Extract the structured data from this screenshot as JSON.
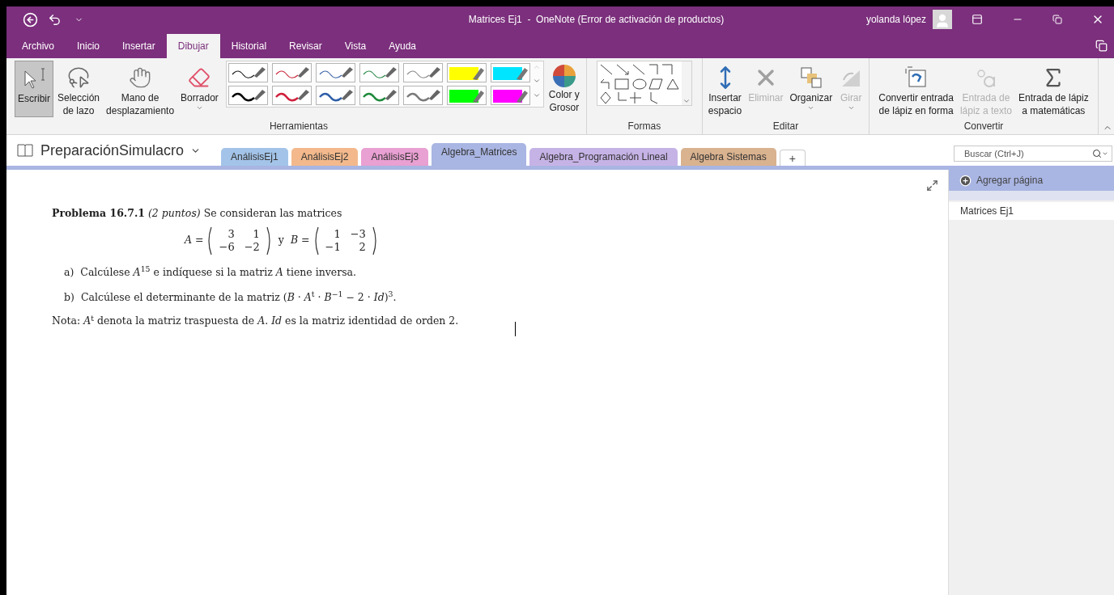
{
  "title_bar": {
    "title": "Matrices Ej1  -  OneNote (Error de activación de productos)",
    "user": "yolanda lópez"
  },
  "menu_tabs": [
    {
      "label": "Archivo",
      "selected": false
    },
    {
      "label": "Inicio",
      "selected": false
    },
    {
      "label": "Insertar",
      "selected": false
    },
    {
      "label": "Dibujar",
      "selected": true
    },
    {
      "label": "Historial",
      "selected": false
    },
    {
      "label": "Revisar",
      "selected": false
    },
    {
      "label": "Vista",
      "selected": false
    },
    {
      "label": "Ayuda",
      "selected": false
    }
  ],
  "ribbon": {
    "tools": {
      "label": "Herramientas",
      "buttons": [
        {
          "kind": "write",
          "lines": [
            "Escribir"
          ],
          "selected": true,
          "dropdown": false
        },
        {
          "kind": "lasso",
          "lines": [
            "Selección",
            "de lazo"
          ],
          "selected": false,
          "dropdown": false
        },
        {
          "kind": "hand",
          "lines": [
            "Mano de",
            "desplazamiento"
          ],
          "selected": false,
          "dropdown": false
        },
        {
          "kind": "eraser",
          "lines": [
            "Borrador"
          ],
          "selected": false,
          "dropdown": true
        }
      ],
      "pens": [
        {
          "kind": "pen",
          "color": "#1a1a1a"
        },
        {
          "kind": "pen",
          "color": "#c8283a"
        },
        {
          "kind": "pen",
          "color": "#3c64a8"
        },
        {
          "kind": "pen",
          "color": "#2e8a4c"
        },
        {
          "kind": "pen",
          "color": "#8a8a8a"
        },
        {
          "kind": "highlighter",
          "color": "#ffff00"
        },
        {
          "kind": "highlighter",
          "color": "#00e5ff"
        },
        {
          "kind": "pen",
          "color": "#000000"
        },
        {
          "kind": "pen",
          "color": "#d0203c"
        },
        {
          "kind": "pen",
          "color": "#2f5fa8"
        },
        {
          "kind": "pen",
          "color": "#1f8a3c"
        },
        {
          "kind": "pen",
          "color": "#7a7a7a"
        },
        {
          "kind": "highlighter",
          "color": "#00ff00"
        },
        {
          "kind": "highlighter",
          "color": "#ff00ff"
        }
      ],
      "color_button": [
        "Color y",
        "Grosor"
      ]
    },
    "shapes": {
      "label": "Formas"
    },
    "edit": {
      "label": "Editar",
      "buttons": [
        {
          "kind": "space",
          "lines": [
            "Insertar",
            "espacio"
          ],
          "disabled": false,
          "dropdown": false
        },
        {
          "kind": "delete",
          "lines": [
            "Eliminar"
          ],
          "disabled": true,
          "dropdown": false
        },
        {
          "kind": "arrange",
          "lines": [
            "Organizar"
          ],
          "disabled": false,
          "dropdown": true
        },
        {
          "kind": "rotate",
          "lines": [
            "Girar"
          ],
          "disabled": true,
          "dropdown": true
        }
      ]
    },
    "convert": {
      "label": "Convertir",
      "buttons": [
        {
          "kind": "shape",
          "lines": [
            "Convertir entrada",
            "de lápiz en forma"
          ],
          "disabled": false
        },
        {
          "kind": "text",
          "lines": [
            "Entrada de",
            "lápiz a texto"
          ],
          "disabled": true
        },
        {
          "kind": "math",
          "lines": [
            "Entrada de lápiz",
            "a matemáticas"
          ],
          "disabled": false
        }
      ]
    }
  },
  "notebook": {
    "name": "PreparaciónSimulacro",
    "sections": [
      {
        "label": "AnálisisEj1",
        "color": "#a3c4e8",
        "selected": false
      },
      {
        "label": "AnálisisEj2",
        "color": "#f3b98c",
        "selected": false
      },
      {
        "label": "AnálisisEj3",
        "color": "#e9a0d2",
        "selected": false
      },
      {
        "label": "Algebra_Matrices",
        "color": "#a9b5e2",
        "selected": true
      },
      {
        "label": "Algebra_Programación Lineal",
        "color": "#c6b3e6",
        "selected": false
      },
      {
        "label": "Algebra Sistemas",
        "color": "#d9b28f",
        "selected": false
      }
    ],
    "add_section": "+"
  },
  "search": {
    "placeholder": "Buscar (Ctrl+J)"
  },
  "pages_panel": {
    "add_page": "Agregar página",
    "pages": [
      {
        "title": "Matrices Ej1",
        "selected": false
      }
    ]
  },
  "note": {
    "heading": "**Problema 16.7.1** *(2 puntos)* Se consideran las matrices",
    "matrices": [
      {
        "name": "*A* =",
        "rows": [
          [
            "3",
            "1"
          ],
          [
            "−6",
            "−2"
          ]
        ]
      },
      {
        "name": "*B* =",
        "rows": [
          [
            "1",
            "−3"
          ],
          [
            "−1",
            "2"
          ]
        ]
      }
    ],
    "conjunction": "y",
    "items": [
      {
        "marker": "a)",
        "text": "Calcúlese *A*$^{15}$ e indíquese si la matriz *A* tiene inversa."
      },
      {
        "marker": "b)",
        "text": "Calcúlese el determinante de la matriz (*B* · *A*$^{t}$ · *B*$^{−1}$ − 2 · *Id*)$^{3}$."
      }
    ],
    "footnote": "Nota: *A*$^{t}$ denota la matriz traspuesta de *A*. *Id* es la matriz identidad de orden 2."
  }
}
